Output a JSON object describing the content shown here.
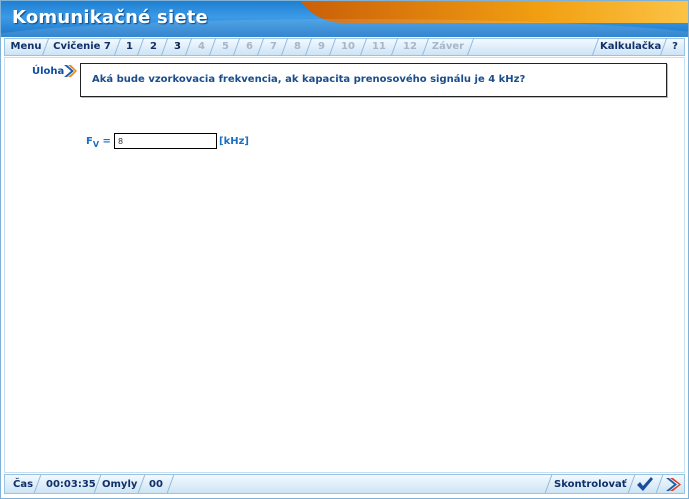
{
  "app": {
    "title": "Komunikačné siete"
  },
  "tabs": [
    {
      "label": "Menu",
      "state": "normal"
    },
    {
      "label": "Cvičenie 7",
      "state": "normal"
    },
    {
      "label": "1",
      "state": "normal"
    },
    {
      "label": "2",
      "state": "normal"
    },
    {
      "label": "3",
      "state": "current"
    },
    {
      "label": "4",
      "state": "disabled"
    },
    {
      "label": "5",
      "state": "disabled"
    },
    {
      "label": "6",
      "state": "disabled"
    },
    {
      "label": "7",
      "state": "disabled"
    },
    {
      "label": "8",
      "state": "disabled"
    },
    {
      "label": "9",
      "state": "disabled"
    },
    {
      "label": "10",
      "state": "disabled"
    },
    {
      "label": "11",
      "state": "disabled"
    },
    {
      "label": "12",
      "state": "disabled"
    },
    {
      "label": "Záver",
      "state": "disabled"
    }
  ],
  "right_tabs": {
    "calculator": "Kalkulačka",
    "help": "?"
  },
  "task": {
    "label": "Úloha",
    "question": "Aká bude vzorkovacia frekvencia, ak kapacita prenosového signálu je 4 kHz?"
  },
  "answer": {
    "var": "F",
    "sub": "V",
    "eq": "=",
    "value": "8",
    "unit": "[kHz]"
  },
  "status": {
    "time_label": "Čas",
    "time_value": "00:03:35",
    "errors_label": "Omyly",
    "errors_value": "00",
    "check_label": "Skontrolovať"
  },
  "colors": {
    "header": "#1e7fd2",
    "accent_orange": "#f2a012",
    "text_blue": "#10306a"
  },
  "icons": {
    "task": "chevron-right-icon",
    "confirm": "checkmark-icon",
    "next": "arrow-right-icon"
  }
}
